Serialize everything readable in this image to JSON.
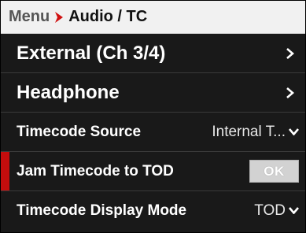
{
  "breadcrumb": {
    "root": "Menu",
    "separator_icon": "chevron-right-icon",
    "current": "Audio / TC"
  },
  "menu": {
    "items": [
      {
        "label": "External (Ch 3/4)",
        "type": "submenu",
        "icon": "chevron-right-icon"
      },
      {
        "label": "Headphone",
        "type": "submenu",
        "icon": "chevron-right-icon"
      },
      {
        "label": "Timecode Source",
        "type": "dropdown",
        "value": "Internal T...",
        "icon": "chevron-down-icon"
      },
      {
        "label": "Jam Timecode to TOD",
        "type": "action",
        "button_label": "OK",
        "selected": true
      },
      {
        "label": "Timecode Display Mode",
        "type": "dropdown",
        "value": "TOD",
        "icon": "chevron-down-icon"
      }
    ]
  },
  "colors": {
    "accent": "#c40d0d",
    "background": "#191919",
    "header_bg": "#f1f1f1",
    "text": "#ffffff"
  }
}
